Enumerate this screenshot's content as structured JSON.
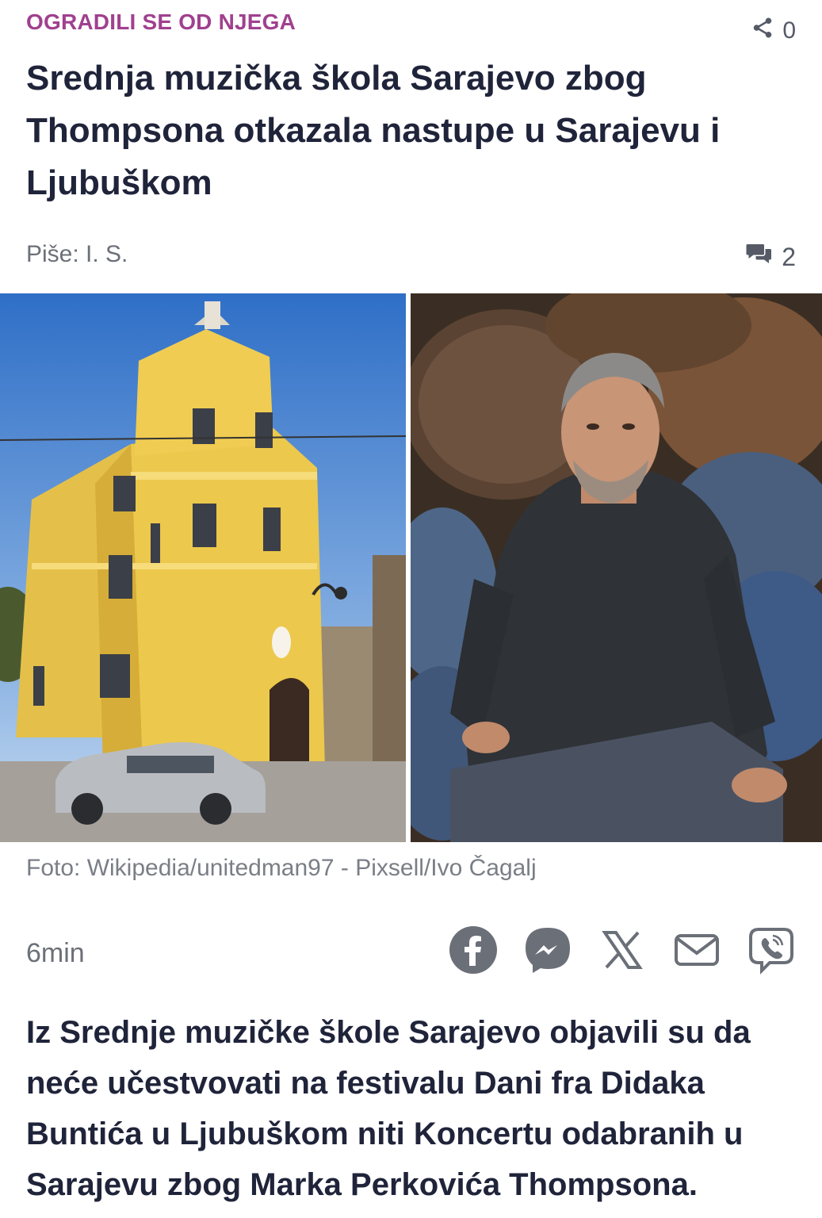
{
  "article": {
    "kicker": "OGRADILI SE OD NJEGA",
    "share_count": "0",
    "headline": "Srednja muzička škola Sarajevo zbog Thompsona otkazala nastupe u Sarajevu i Ljubuškom",
    "author": "Piše: I. S.",
    "comment_count": "2",
    "photo_caption": "Foto: Wikipedia/unitedman97 - Pixsell/Ivo Čagalj",
    "read_time": "6min",
    "lead": "Iz Srednje muzičke škole Sarajevo objavili su da neće učestvovati na festivalu Dani fra Didaka Buntića u Ljubuškom niti Koncertu odabranih u Sarajevu zbog Marka Perkovića Thompsona."
  },
  "icons": {
    "share": "share-icon",
    "comments": "comments-icon",
    "facebook": "facebook-icon",
    "messenger": "messenger-icon",
    "x": "x-icon",
    "email": "email-icon",
    "viber": "viber-icon"
  },
  "colors": {
    "kicker": "#a0408f",
    "headline": "#20243a",
    "meta": "#6c7078",
    "icon": "#6b6f78"
  }
}
